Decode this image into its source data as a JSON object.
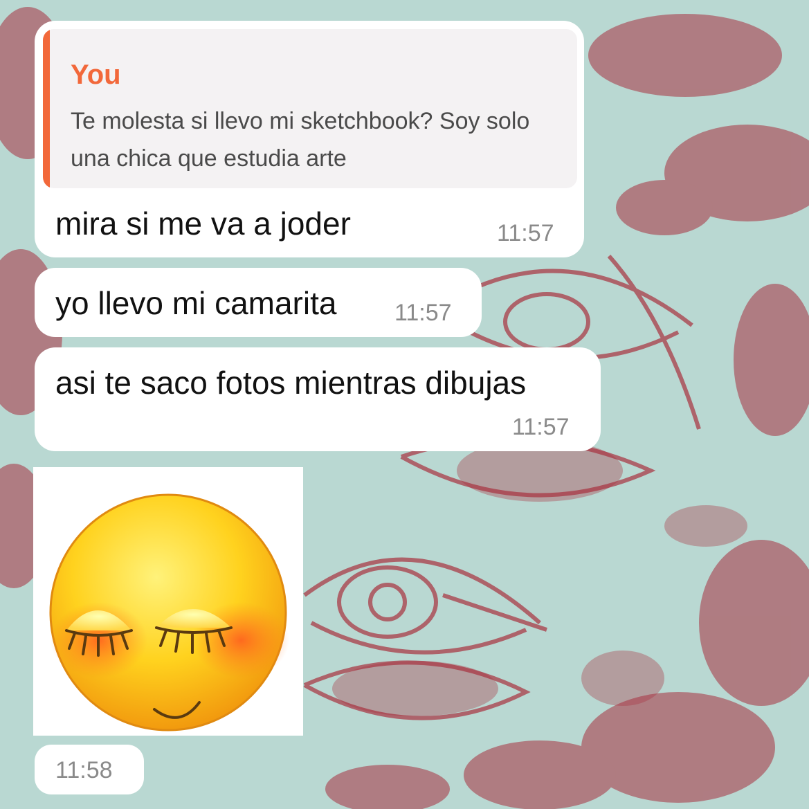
{
  "chat": {
    "messages": [
      {
        "reply_to": {
          "author": "You",
          "text": "Te molesta si llevo mi sketchbook? Soy solo una chica que estudia arte"
        },
        "text": "mira si me va a joder",
        "time": "11:57"
      },
      {
        "text": "yo llevo mi camarita",
        "time": "11:57"
      },
      {
        "text": "asi te saco fotos mientras dibujas",
        "time": "11:57"
      },
      {
        "sticker": "blushing-smiley-closed-eyes-icon",
        "time": "11:58"
      }
    ]
  },
  "colors": {
    "wallpaper": "#b9d8d2",
    "wallpaper_art": "#a8323f",
    "bubble": "#ffffff",
    "reply_accent": "#f2683a",
    "timestamp": "#8a8a8a"
  }
}
